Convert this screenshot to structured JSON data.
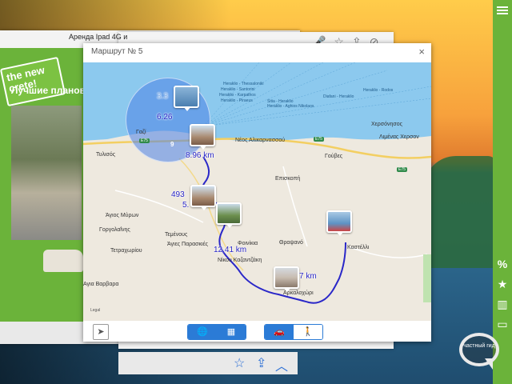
{
  "site": {
    "logo_text": "the new crete!",
    "back_title": "Аренда Ipad 4G и",
    "heading": "Лучшие плановы"
  },
  "dialog": {
    "title": "Маршрут № 5",
    "close": "×",
    "legal": "Legal"
  },
  "map": {
    "sea_labels": [
      "Heraklio - Thessaloniki",
      "Heraklio - Santorini",
      "Heraklio - Karpathos",
      "Heraklio - Piraeus",
      "Sitia - Heraklio",
      "Heraklio - Aghios Nikolaos",
      "Diafani - Heraklio",
      "Heraklio - Rodos"
    ],
    "places": [
      "Χερσόνησος",
      "Λιμένας Χερσον",
      "Νέος Αλικαρνασσού",
      "Γαζί",
      "Τυλισός",
      "Γούβες",
      "Επισκοπή",
      "Άγιος Μύρων",
      "Γοργολαΐνης",
      "Τεμένους",
      "Άγιες Παρασκιές",
      "Φοινίκια",
      "Θραψανό",
      "Καστέλλι",
      "Τετραχωρίου",
      "Νίκου Καζαντζάκη",
      "Αγια Βαρβαρα",
      "Αρκαλοχώρι"
    ],
    "road_badges": [
      "E75",
      "E75",
      "E75"
    ],
    "cluster_count": "9",
    "route_labels": {
      "cluster_top": "3.3",
      "cluster_mid": "6.26",
      "leg1": "8.96 km",
      "leg2": "493",
      "leg3": "5.",
      "leg4": "12.41 km",
      "leg5": "7 km"
    }
  },
  "footer": {
    "locate_icon": "➤",
    "globe_icon": "🌐",
    "map_icon": "▦",
    "car_icon": "🚗",
    "walk_icon": "🚶"
  },
  "sidebar": {
    "bubble_text": "частный гид"
  },
  "bottom": {
    "star": "☆",
    "share": "⇪",
    "up": "︿"
  },
  "colors": {
    "brand_green": "#6bb33a",
    "route_blue": "#2a27c8",
    "accent_blue": "#2b7bd6"
  }
}
